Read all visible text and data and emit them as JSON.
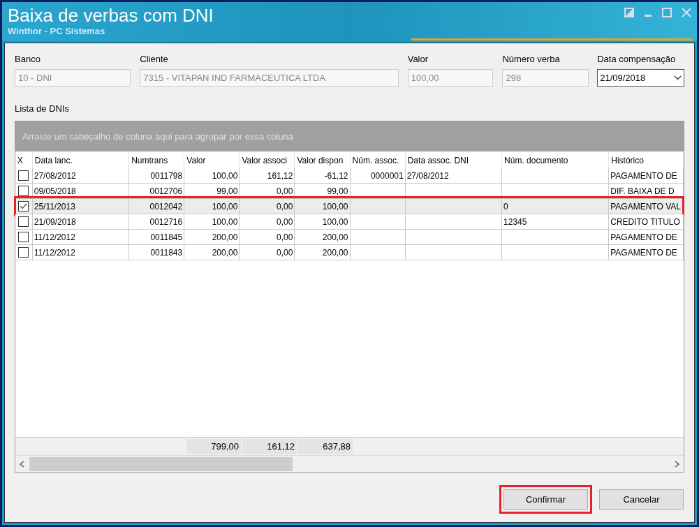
{
  "window": {
    "title": "Baixa de verbas com DNI",
    "subtitle": "Winthor - PC Sistemas"
  },
  "fields": [
    {
      "label": "Banco",
      "value": "10 - DNI",
      "kind": "text"
    },
    {
      "label": "Cliente",
      "value": "7315 - VITAPAN IND FARMACEUTICA LTDA",
      "kind": "text"
    },
    {
      "label": "Valor",
      "value": "100,00",
      "kind": "text"
    },
    {
      "label": "Número verba",
      "value": "298",
      "kind": "text"
    },
    {
      "label": "Data compensação",
      "value": "21/09/2018",
      "kind": "dropdown"
    }
  ],
  "list_label": "Lista de DNIs",
  "group_panel": "Arraste um cabeçalho de coluna aqui para agrupar por essa coluna",
  "table": {
    "checkbox_column": "X",
    "columns": [
      "Data lanc.",
      "Numtrans",
      "Valor",
      "Valor associ",
      "Valor dispon",
      "Núm. assoc.",
      "Data assoc. DNI",
      "Núm. documento",
      "Histórico"
    ],
    "rows": [
      {
        "checked": false,
        "highlighted": false,
        "cells": [
          "27/08/2012",
          "0011798",
          "100,00",
          "161,12",
          "-61,12",
          "0000001",
          "27/08/2012",
          "",
          "PAGAMENTO DE"
        ]
      },
      {
        "checked": false,
        "highlighted": false,
        "cells": [
          "09/05/2018",
          "0012706",
          "99,00",
          "0,00",
          "99,00",
          "",
          "",
          "",
          "DIF. BAIXA DE D"
        ]
      },
      {
        "checked": true,
        "highlighted": true,
        "cells": [
          "25/11/2013",
          "0012042",
          "100,00",
          "0,00",
          "100,00",
          "",
          "",
          "0",
          "PAGAMENTO VAL"
        ]
      },
      {
        "checked": false,
        "highlighted": false,
        "cells": [
          "21/09/2018",
          "0012716",
          "100,00",
          "0,00",
          "100,00",
          "",
          "",
          "12345",
          "CREDITO TITULO"
        ]
      },
      {
        "checked": false,
        "highlighted": false,
        "cells": [
          "11/12/2012",
          "0011845",
          "200,00",
          "0,00",
          "200,00",
          "",
          "",
          "",
          "PAGAMENTO DE"
        ]
      },
      {
        "checked": false,
        "highlighted": false,
        "cells": [
          "11/12/2012",
          "0011843",
          "200,00",
          "0,00",
          "200,00",
          "",
          "",
          "",
          "PAGAMENTO DE"
        ]
      }
    ],
    "totals": [
      "799,00",
      "161,12",
      "637,88"
    ]
  },
  "buttons": [
    {
      "label": "Confirmar",
      "highlighted": true
    },
    {
      "label": "Cancelar",
      "highlighted": false
    }
  ]
}
